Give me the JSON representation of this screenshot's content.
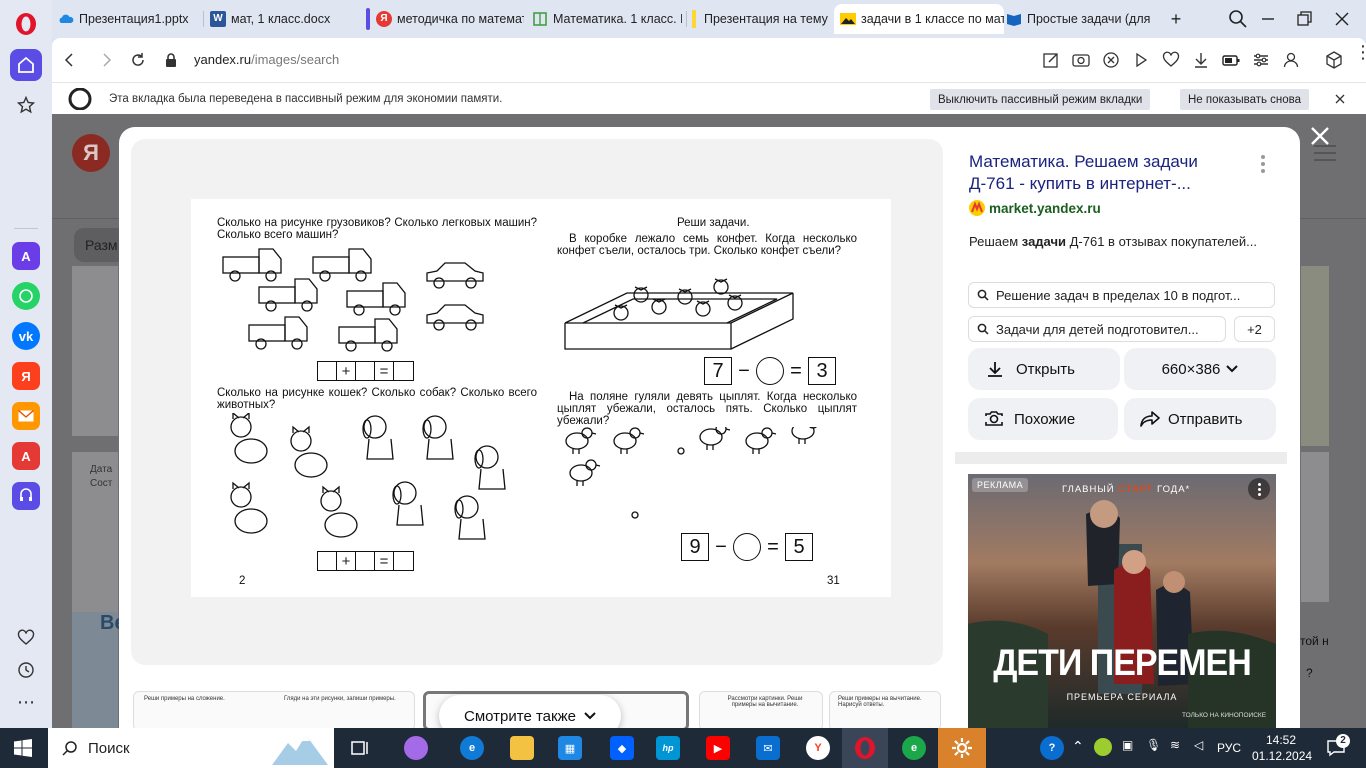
{
  "tabs": [
    {
      "label": "Презентация1.pptx",
      "color": "#1e88e5"
    },
    {
      "label": "мат, 1 класс.docx",
      "color": "#2b579a"
    },
    {
      "label": "методичка по математ",
      "color": "#e53935"
    },
    {
      "label": "Математика. 1 класс. Г",
      "color": "#43a047"
    },
    {
      "label": "Презентация на тему",
      "color": "#fdd835"
    },
    {
      "label": "задачи в 1 классе по мат",
      "color": "#222222",
      "active": true
    },
    {
      "label": "Простые задачи (для",
      "color": "#1565c0"
    }
  ],
  "address": {
    "domain": "yandex.ru",
    "path": "/images/search"
  },
  "notification": {
    "text": "Эта вкладка была переведена в пассивный режим для экономии памяти.",
    "disable_label": "Выключить пассивный режим вкладки",
    "dont_show_label": "Не показывать снова"
  },
  "page_bg": {
    "logo": "Я",
    "search_prefix": "Разм",
    "right_fragment_1": "той н",
    "right_fragment_2": "?",
    "left_fragment": "Ве",
    "left_fragment_2": "Дата",
    "left_fragment_3": "Сост"
  },
  "worksheet": {
    "task1": "Сколько на рисунке грузовиков? Сколько легковых машин? Сколько всего машин?",
    "task2": "Сколько на рисунке кошек? Сколько собак? Сколько всего животных?",
    "task3_title": "Реши задачи.",
    "task3": "В коробке лежало семь конфет. Когда несколько конфет съели, осталось три. Сколько конфет съели?",
    "task4": "На поляне гуляли девять цыплят. Когда несколько цыплят убежали, осталось пять. Сколько цыплят убежали?",
    "plus": "+",
    "equals": "=",
    "minus": "−",
    "eq1_a": "7",
    "eq1_b": "3",
    "eq2_a": "9",
    "eq2_b": "5",
    "page_left": "2",
    "page_right": "31"
  },
  "thumbs": {
    "t1": "Реши примеры на сложение.",
    "t2": "Гляди на эти рисунки, запиши примеры.",
    "t3": "Рассмотри картинки. Реши примеры на вычитание.",
    "t4": "Реши примеры на вычитание. Нарисуй ответы."
  },
  "see_also": "Смотрите также",
  "info": {
    "title": "Математика. Решаем задачи Д-761 - купить в интернет-...",
    "site": "market.yandex.ru",
    "desc_pre": "Решаем ",
    "desc_bold": "задачи",
    "desc_post": " Д-761 в отзывах покупателей...",
    "chip1": "Решение задач в пределах 10 в подгот...",
    "chip2": "Задачи для детей подготовител...",
    "chip_more": "+2",
    "open": "Открыть",
    "size": "660×386",
    "similar": "Похожие",
    "share": "Отправить"
  },
  "ad": {
    "badge": "РЕКЛАМА",
    "tag_pre": "ГЛАВНЫЙ ",
    "tag_mid": "СТАРТ",
    "tag_post": " ГОДА*",
    "title": "ДЕТИ ПЕРЕМЕН",
    "subtitle": "ПРЕМЬЕРА СЕРИАЛА",
    "footer": "ТОЛЬКО НА КИНОПОИСКЕ"
  },
  "taskbar": {
    "search": "Поиск",
    "lang": "РУС",
    "time": "14:52",
    "date": "01.12.2024",
    "notif_count": "2"
  },
  "colors": {
    "accent_opera": "#e0142b",
    "link": "#1a237e",
    "site_green": "#1b5e20"
  }
}
